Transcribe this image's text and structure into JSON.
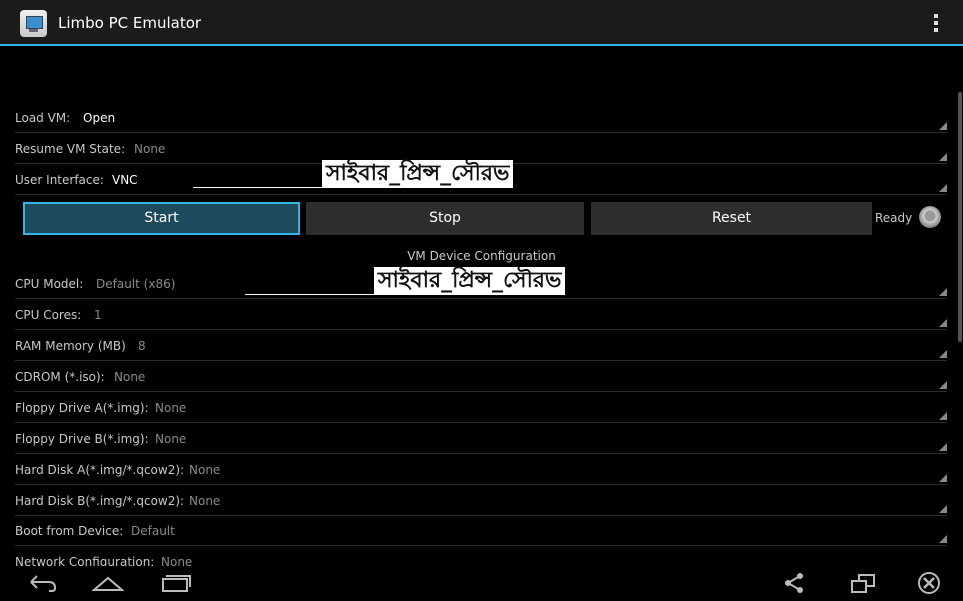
{
  "app": {
    "title": "Limbo PC Emulator",
    "icon": "limbo-app-icon",
    "accent_color": "#33b5e5"
  },
  "top_settings": [
    {
      "label": "Load VM:",
      "value": "Open"
    },
    {
      "label": "Resume VM State:",
      "value": "None"
    },
    {
      "label": "User Interface:",
      "value": "VNC"
    }
  ],
  "controls": {
    "start": "Start",
    "stop": "Stop",
    "reset": "Reset",
    "status": "Ready"
  },
  "device_config": {
    "title": "VM Device Configuration",
    "rows": [
      {
        "label": "CPU Model:",
        "value": "Default (x86)"
      },
      {
        "label": "CPU Cores:",
        "value": "1"
      },
      {
        "label": "RAM Memory (MB)",
        "value": "8"
      },
      {
        "label": "CDROM (*.iso):",
        "value": "None"
      },
      {
        "label": "Floppy Drive A(*.img):",
        "value": "None"
      },
      {
        "label": "Floppy Drive B(*.img):",
        "value": "None"
      },
      {
        "label": "Hard Disk A(*.img/*.qcow2):",
        "value": "None"
      },
      {
        "label": "Hard Disk B(*.img/*.qcow2):",
        "value": "None"
      },
      {
        "label": "Boot from Device:",
        "value": "Default"
      },
      {
        "label": "Network Configuration:",
        "value": "None"
      }
    ]
  },
  "watermark": {
    "text": "সাইবার_প্রিন্স_সৌরভ"
  },
  "navbar": {
    "icons": [
      "back-icon",
      "home-icon",
      "recents-icon",
      "share-icon",
      "window-icon",
      "close-icon"
    ]
  }
}
